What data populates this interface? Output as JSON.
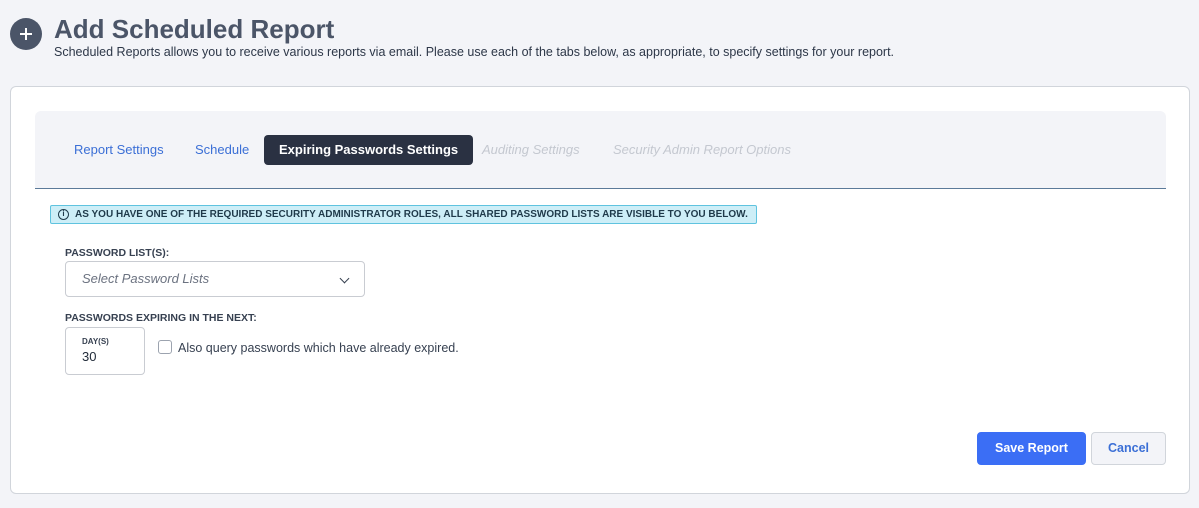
{
  "header": {
    "title": "Add Scheduled Report",
    "subtitle": "Scheduled Reports allows you to receive various reports via email. Please use each of the tabs below, as appropriate, to specify settings for your report."
  },
  "tabs": [
    {
      "label": "Report Settings",
      "state": "link"
    },
    {
      "label": "Schedule",
      "state": "link"
    },
    {
      "label": "Expiring Passwords Settings",
      "state": "active"
    },
    {
      "label": "Auditing Settings",
      "state": "disabled"
    },
    {
      "label": "Security Admin Report Options",
      "state": "disabled"
    }
  ],
  "alert": {
    "icon": "info-icon",
    "text": "AS YOU HAVE ONE OF THE REQUIRED SECURITY ADMINISTRATOR ROLES, ALL SHARED PASSWORD LISTS ARE VISIBLE TO YOU BELOW."
  },
  "form": {
    "password_lists_label": "PASSWORD LIST(S):",
    "password_lists_placeholder": "Select Password Lists",
    "expiring_label": "PASSWORDS EXPIRING IN THE NEXT:",
    "days_unit": "DAY(S)",
    "days_value": "30",
    "expired_checkbox_label": "Also query passwords which have already expired.",
    "expired_checked": false
  },
  "buttons": {
    "save": "Save Report",
    "cancel": "Cancel"
  },
  "colors": {
    "primary": "#3b6ef5",
    "link": "#3b6fd6",
    "active_tab": "#2a3142",
    "alert_bg": "#cdeef7",
    "alert_border": "#5fc3df"
  }
}
